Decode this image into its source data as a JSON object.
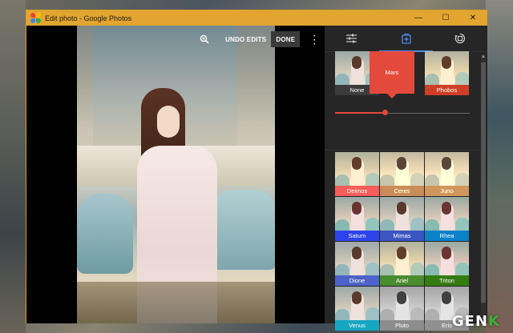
{
  "window": {
    "title": "Edit photo - Google Photos",
    "minimize_glyph": "—",
    "maximize_glyph": "☐",
    "close_glyph": "✕",
    "titlebar_color": "#e2a530"
  },
  "toolbar": {
    "zoom_icon": "zoom-in-icon",
    "undo_label": "UNDO EDITS",
    "done_label": "DONE",
    "more_glyph": "⋮"
  },
  "panel": {
    "tabs": [
      {
        "name": "adjustments",
        "icon": "sliders-icon",
        "active": false
      },
      {
        "name": "filters",
        "icon": "filter-add-icon",
        "active": true
      },
      {
        "name": "crop-rotate",
        "icon": "rotate-icon",
        "active": false
      }
    ],
    "accent": "#4e8cf2",
    "selected_filter": {
      "label": "Mars",
      "color": "#e34a3b",
      "intensity": 0.37
    },
    "top_row": [
      {
        "label": "None",
        "color": "#3b3b3b"
      },
      {
        "label": "Mars",
        "color": "#e34a3b"
      },
      {
        "label": "Phobos",
        "color": "#c23529"
      }
    ],
    "grid": [
      {
        "label": "Deimos",
        "color": "#e5515d"
      },
      {
        "label": "Ceres",
        "color": "#e96d22"
      },
      {
        "label": "Juno",
        "color": "#e97a1f"
      },
      {
        "label": "Saturn",
        "color": "#6138c7"
      },
      {
        "label": "Mimas",
        "color": "#3b55c0"
      },
      {
        "label": "Rhea",
        "color": "#3e72c8"
      },
      {
        "label": "Dione",
        "color": "#4d63c9"
      },
      {
        "label": "Ariel",
        "color": "#3f8a3a"
      },
      {
        "label": "Triton",
        "color": "#2b7b35"
      },
      {
        "label": "Venus",
        "color": "#16a6c2"
      },
      {
        "label": "Pluto",
        "color": "#8d8d8d"
      },
      {
        "label": "Eris",
        "color": "#9c8f86"
      }
    ]
  },
  "watermark": {
    "text": "GEN",
    "accent_letter": "K"
  }
}
